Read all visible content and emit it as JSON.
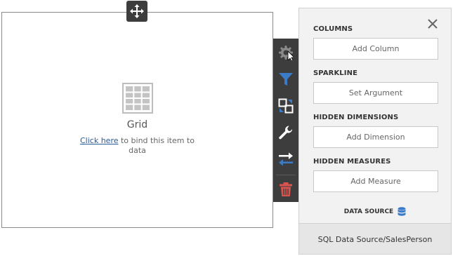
{
  "item": {
    "title": "Grid",
    "link_text": "Click here",
    "bind_suffix": " to bind this item to data"
  },
  "toolbar": {
    "icons": [
      "gear-icon",
      "filter-icon",
      "convert-icon",
      "wrench-icon",
      "interactivity-icon",
      "delete-icon"
    ]
  },
  "panel": {
    "sections": [
      {
        "label": "COLUMNS",
        "button": "Add Column"
      },
      {
        "label": "SPARKLINE",
        "button": "Set Argument"
      },
      {
        "label": "HIDDEN DIMENSIONS",
        "button": "Add Dimension"
      },
      {
        "label": "HIDDEN MEASURES",
        "button": "Add Measure"
      }
    ],
    "data_source_label": "DATA SOURCE",
    "data_source_value": "SQL Data Source/SalesPerson"
  },
  "colors": {
    "accent": "#3b7bc8",
    "toolbar_bg": "#3d3d3d",
    "delete": "#d9534f"
  }
}
